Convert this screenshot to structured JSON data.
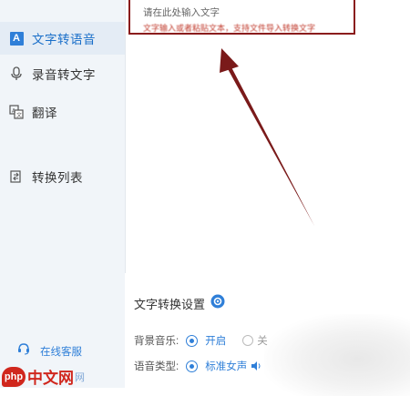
{
  "sidebar": {
    "items": [
      {
        "label": "文字转语音",
        "icon": "text-to-speech-icon",
        "active": true
      },
      {
        "label": "录音转文字",
        "icon": "microphone-icon",
        "active": false
      },
      {
        "label": "翻译",
        "icon": "translate-icon",
        "active": false
      },
      {
        "label": "转换列表",
        "icon": "convert-list-icon",
        "active": false
      }
    ],
    "support_label": "在线客服"
  },
  "editor": {
    "placeholder": "请在此处输入文字",
    "hint": "文字输入或者粘贴文本，支持文件导入转换文字"
  },
  "settings": {
    "title": "文字转换设置",
    "background_music": {
      "label": "背景音乐:",
      "selected": "开启",
      "other": "关"
    },
    "voice_type": {
      "label": "语音类型:",
      "selected": "标准女声"
    }
  },
  "watermark": {
    "badge": "php",
    "text": "中文网",
    "suffix": "网"
  },
  "colors": {
    "accent": "#2f7fd8",
    "arrow": "#7a1a1a",
    "watermark": "#d0271d"
  }
}
